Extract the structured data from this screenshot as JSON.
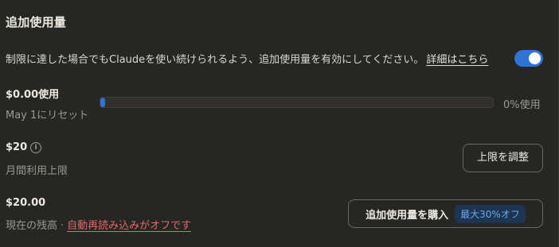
{
  "section": {
    "title": "追加使用量"
  },
  "description": {
    "text": "制限に達した場合でもClaudeを使い続けられるよう、追加使用量を有効にしてください。",
    "link": "詳細はこちら"
  },
  "toggle": {
    "enabled": true,
    "color": "#2f73d4"
  },
  "usage": {
    "amount": "$0.00使用",
    "reset": "May 1にリセット",
    "progress_fraction": 0.0,
    "progress_label": "0%使用"
  },
  "limit": {
    "amount": "$20",
    "info_icon": "i",
    "label": "月間利用上限",
    "button": "上限を調整"
  },
  "balance": {
    "amount": "$20.00",
    "label": "現在の残高",
    "separator": "·",
    "autoreload": "自動再読み込みがオフです",
    "buy_button": "追加使用量を購入",
    "discount_badge": "最大30%オフ",
    "warn_color": "#e06a6a"
  }
}
